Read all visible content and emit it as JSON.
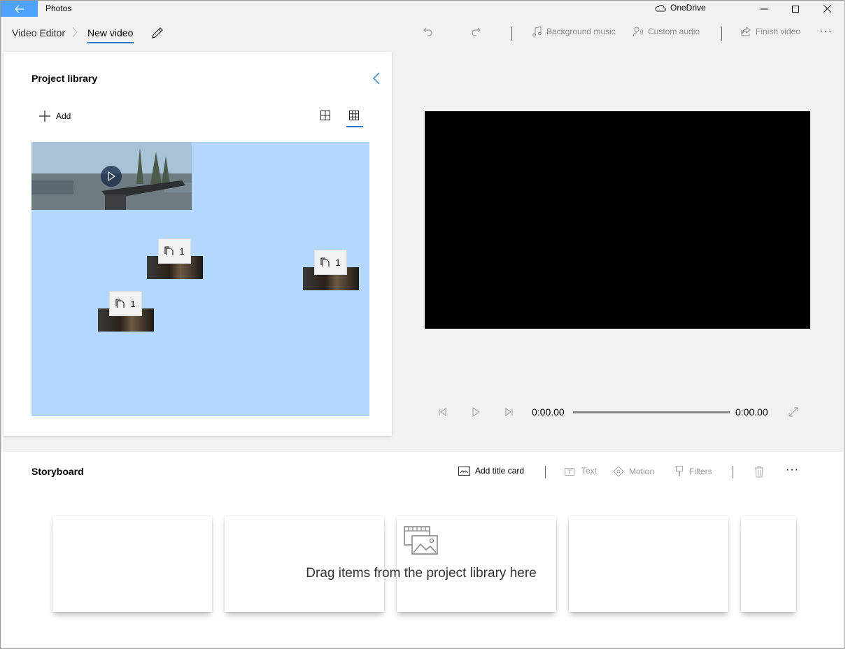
{
  "app": {
    "title": "Photos",
    "onedrive_label": "OneDrive"
  },
  "breadcrumb": {
    "parent": "Video Editor",
    "current": "New video"
  },
  "toolbar": {
    "background_music": "Background music",
    "custom_audio": "Custom audio",
    "finish_video": "Finish video",
    "more": "···"
  },
  "library": {
    "title": "Project library",
    "add_label": "Add",
    "drag_items": [
      {
        "count": "1"
      },
      {
        "count": "1"
      },
      {
        "count": "1"
      }
    ]
  },
  "playback": {
    "current_time": "0:00.00",
    "total_time": "0:00.00"
  },
  "storyboard": {
    "title": "Storyboard",
    "add_title_card": "Add title card",
    "text": "Text",
    "motion": "Motion",
    "filters": "Filters",
    "more": "···",
    "placeholder": "Drag items from the project library here"
  },
  "colors": {
    "accent": "#2a7bd4",
    "back_button": "#4da3ff",
    "library_drop_area": "#b3d7fd",
    "preview": "#000000"
  }
}
